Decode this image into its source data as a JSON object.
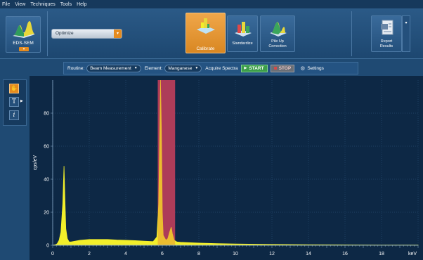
{
  "menu": [
    "File",
    "View",
    "Techniques",
    "Tools",
    "Help"
  ],
  "ribbon": {
    "mode_label": "EDS-SEM",
    "dropdown_value": "Optimize",
    "calibrate_label": "Calibrate",
    "standardize_label": "Standardize",
    "pileup_line1": "Pile Up",
    "pileup_line2": "Correction",
    "report_line1": "Report",
    "report_line2": "Results"
  },
  "controls": {
    "routine_label": "Routine:",
    "routine_value": "Beam Measurement",
    "element_label": "Element:",
    "element_value": "Manganese",
    "acquire_label": "Acquire Spectra",
    "start_label": "START",
    "stop_label": "STOP",
    "settings_label": "Settings"
  },
  "tools": {
    "text_tool_label": "T",
    "info_tool_label": "i"
  },
  "colors": {
    "accent_orange": "#e58b1f",
    "spectrum": "#f2ef2a",
    "roi_band": "#a1286f",
    "plot_bg": "#0d2845"
  },
  "chart_data": {
    "type": "area",
    "ylabel": "cps/eV",
    "xlabel": "keV",
    "xlim": [
      0,
      20
    ],
    "ylim": [
      0,
      100
    ],
    "x_ticks": [
      0,
      2,
      4,
      6,
      8,
      10,
      12,
      14,
      16,
      18
    ],
    "y_ticks": [
      0,
      20,
      40,
      60,
      80
    ],
    "roi_kev": [
      5.75,
      6.7
    ],
    "spectrum": [
      [
        0.0,
        0
      ],
      [
        0.15,
        0.3
      ],
      [
        0.25,
        1
      ],
      [
        0.35,
        3
      ],
      [
        0.45,
        8
      ],
      [
        0.55,
        25
      ],
      [
        0.62,
        48
      ],
      [
        0.67,
        28
      ],
      [
        0.72,
        10
      ],
      [
        0.8,
        4
      ],
      [
        0.9,
        2
      ],
      [
        1.0,
        2
      ],
      [
        1.5,
        3
      ],
      [
        2.0,
        3.5
      ],
      [
        2.5,
        3.5
      ],
      [
        3.0,
        3.5
      ],
      [
        3.5,
        3.2
      ],
      [
        4.0,
        3.0
      ],
      [
        4.5,
        2.8
      ],
      [
        5.0,
        2.5
      ],
      [
        5.5,
        2.2
      ],
      [
        5.7,
        5
      ],
      [
        5.8,
        25
      ],
      [
        5.85,
        60
      ],
      [
        5.9,
        100
      ],
      [
        5.95,
        70
      ],
      [
        6.0,
        20
      ],
      [
        6.05,
        6
      ],
      [
        6.2,
        3
      ],
      [
        6.3,
        4
      ],
      [
        6.4,
        8
      ],
      [
        6.49,
        11
      ],
      [
        6.55,
        7
      ],
      [
        6.65,
        3
      ],
      [
        6.8,
        2
      ],
      [
        7.0,
        1.8
      ],
      [
        8.0,
        1.3
      ],
      [
        9.0,
        1.0
      ],
      [
        10.0,
        0.8
      ],
      [
        12.0,
        0.5
      ],
      [
        14.0,
        0.3
      ],
      [
        16.0,
        0.2
      ],
      [
        18.0,
        0.1
      ],
      [
        20.0,
        0.1
      ]
    ]
  }
}
